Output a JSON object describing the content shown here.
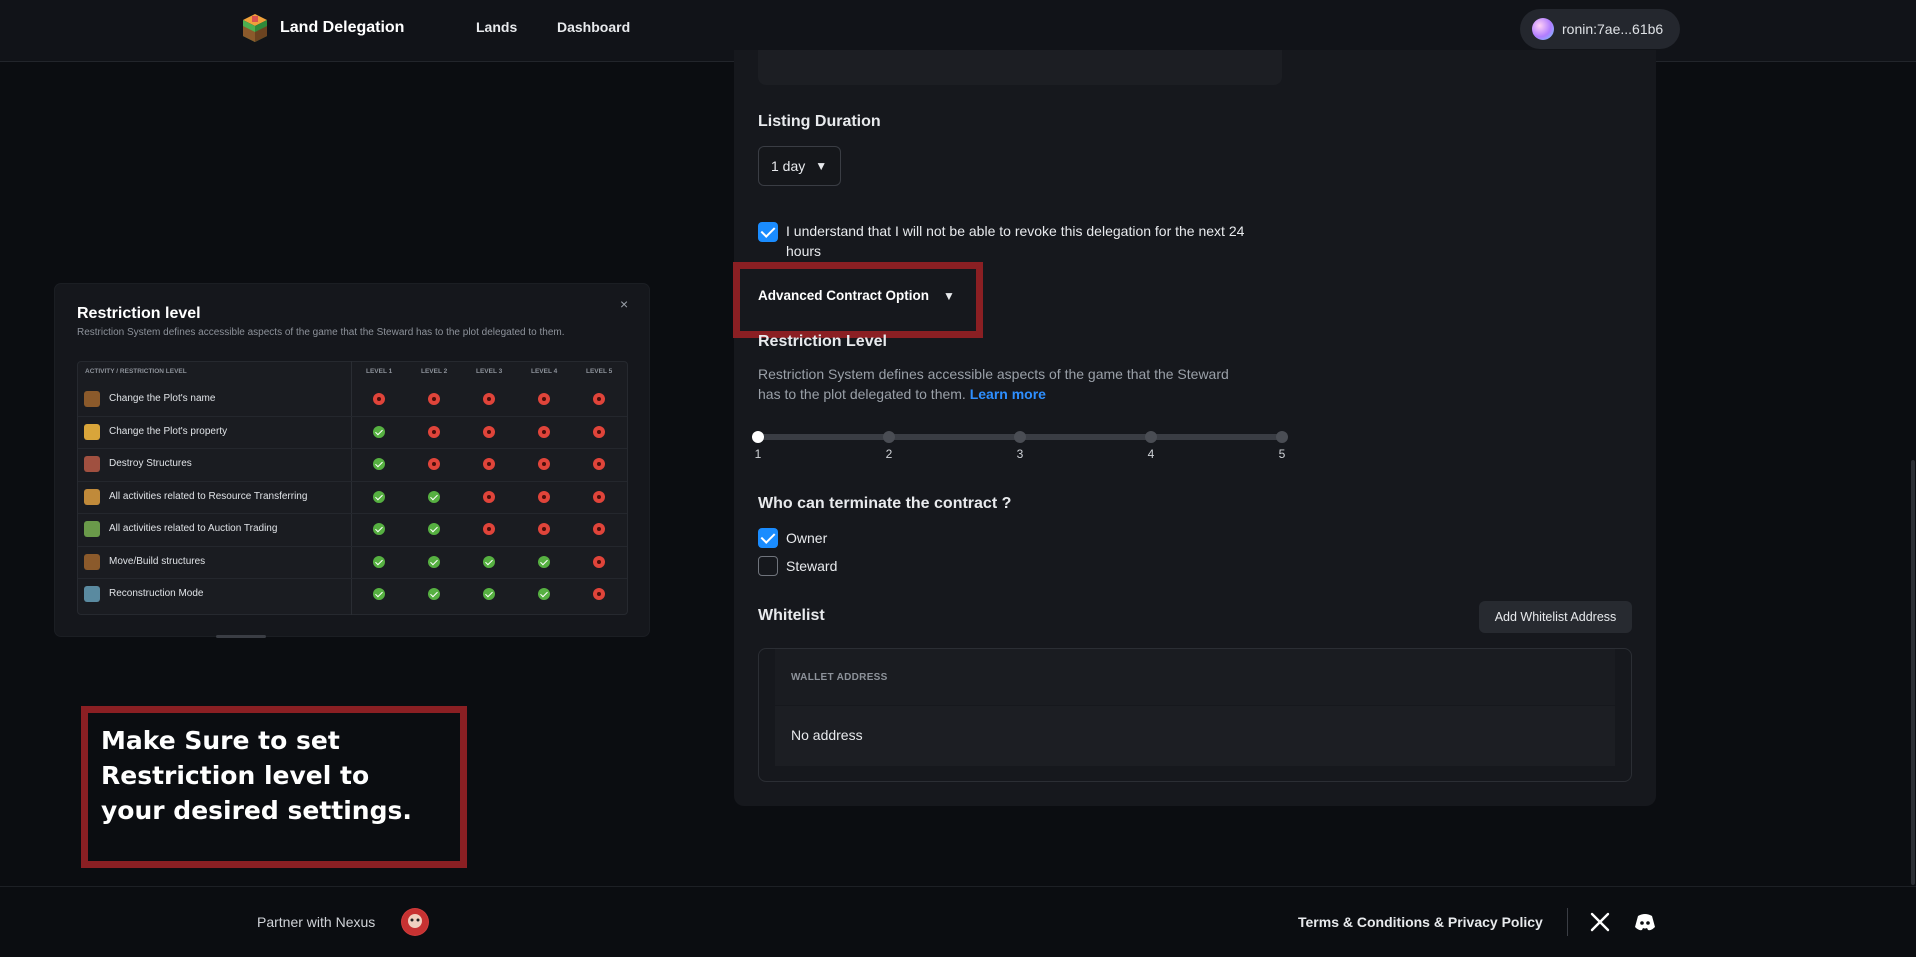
{
  "header": {
    "brand": "Land Delegation",
    "nav": [
      "Lands",
      "Dashboard"
    ],
    "wallet": "ronin:7ae...61b6"
  },
  "form": {
    "listing_duration_label": "Listing Duration",
    "duration_value": "1 day",
    "understand_text": "I understand that I will not be able to revoke this delegation for the next 24 hours",
    "understand_checked": true,
    "advanced_option": "Advanced Contract Option",
    "restriction_title": "Restriction Level",
    "restriction_desc": "Restriction System defines accessible aspects of the game that the Steward has to the plot delegated to them.",
    "learn_more": "Learn more",
    "levels": [
      "1",
      "2",
      "3",
      "4",
      "5"
    ],
    "selected_level": 1,
    "terminate_title": "Who can terminate the contract ?",
    "owner_label": "Owner",
    "owner_checked": true,
    "steward_label": "Steward",
    "steward_checked": false,
    "whitelist_title": "Whitelist",
    "add_whitelist": "Add Whitelist Address",
    "wallet_col": "WALLET ADDRESS",
    "no_address": "No address"
  },
  "restriction_card": {
    "title": "Restriction level",
    "subtitle": "Restriction System defines accessible aspects of the game that the Steward has to the plot delegated to them.",
    "close": "×",
    "headers": [
      "ACTIVITY / RESTRICTION LEVEL",
      "LEVEL 1",
      "LEVEL 2",
      "LEVEL 3",
      "LEVEL 4",
      "LEVEL 5"
    ],
    "rows": [
      {
        "activity": "Change the Plot's name",
        "levels": [
          false,
          false,
          false,
          false,
          false
        ]
      },
      {
        "activity": "Change the Plot's property",
        "levels": [
          true,
          false,
          false,
          false,
          false
        ]
      },
      {
        "activity": "Destroy Structures",
        "levels": [
          true,
          false,
          false,
          false,
          false
        ]
      },
      {
        "activity": "All activities related to Resource Transferring",
        "levels": [
          true,
          true,
          false,
          false,
          false
        ]
      },
      {
        "activity": "All activities related to Auction Trading",
        "levels": [
          true,
          true,
          false,
          false,
          false
        ]
      },
      {
        "activity": "Move/Build structures",
        "levels": [
          true,
          true,
          true,
          true,
          false
        ]
      },
      {
        "activity": "Reconstruction Mode",
        "levels": [
          true,
          true,
          true,
          true,
          false
        ]
      }
    ]
  },
  "callout": "Make Sure to set Restriction level to your desired settings.",
  "footer": {
    "partner": "Partner with Nexus",
    "terms": "Terms & Conditions & Privacy Policy"
  },
  "icons": {
    "brand": "land-cube-icon",
    "social": [
      "x-icon",
      "discord-icon"
    ]
  },
  "colors": {
    "accent": "#1a8cff",
    "highlight": "#8b1f23",
    "allowed": "#56b041",
    "blocked": "#e0443a"
  }
}
